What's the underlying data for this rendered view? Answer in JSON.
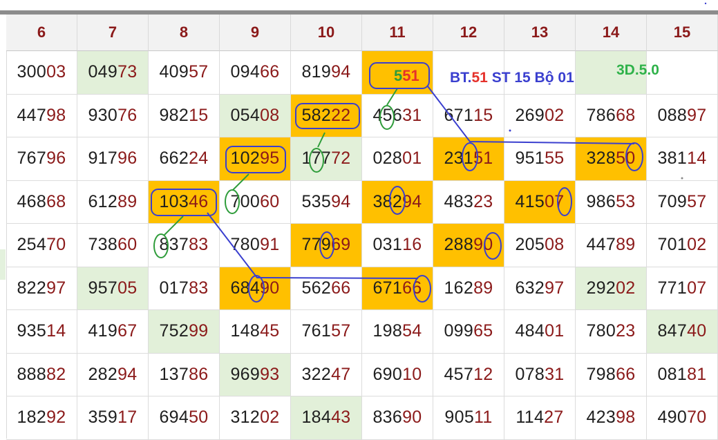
{
  "headers": [
    "6",
    "7",
    "8",
    "9",
    "10",
    "11",
    "12",
    "13",
    "14",
    "15"
  ],
  "rows": [
    [
      {
        "h": "300",
        "l": "03"
      },
      {
        "h": "049",
        "l": "73",
        "g": 1
      },
      {
        "h": "409",
        "l": "57"
      },
      {
        "h": "094",
        "l": "66"
      },
      {
        "h": "819",
        "l": "94"
      },
      {
        "o": 1,
        "blank": 1
      },
      {
        "blank": 1
      },
      {
        "blank": 1
      },
      {
        "g": 1,
        "blank": 1
      },
      {
        "blank": 1
      }
    ],
    [
      {
        "h": "447",
        "l": "98"
      },
      {
        "h": "930",
        "l": "76"
      },
      {
        "h": "982",
        "l": "15"
      },
      {
        "h": "054",
        "l": "08",
        "g": 1
      },
      {
        "h": "582",
        "l": "22",
        "o": 1
      },
      {
        "h": "456",
        "l": "31"
      },
      {
        "h": "671",
        "l": "15"
      },
      {
        "h": "269",
        "l": "02"
      },
      {
        "h": "786",
        "l": "68"
      },
      {
        "h": "088",
        "l": "97"
      }
    ],
    [
      {
        "h": "767",
        "l": "96"
      },
      {
        "h": "917",
        "l": "96"
      },
      {
        "h": "662",
        "l": "24"
      },
      {
        "h": "102",
        "l": "95",
        "o": 1
      },
      {
        "h": "177",
        "l": "72",
        "g": 1
      },
      {
        "h": "028",
        "l": "01"
      },
      {
        "h": "231",
        "l": "51",
        "o": 1
      },
      {
        "h": "951",
        "l": "55"
      },
      {
        "h": "328",
        "l": "50",
        "o": 1
      },
      {
        "h": "381",
        "l": "14"
      }
    ],
    [
      {
        "h": "468",
        "l": "68"
      },
      {
        "h": "612",
        "l": "89"
      },
      {
        "h": "103",
        "l": "46",
        "o": 1
      },
      {
        "h": "700",
        "l": "60"
      },
      {
        "h": "535",
        "l": "94"
      },
      {
        "h": "382",
        "l": "94",
        "o": 1
      },
      {
        "h": "483",
        "l": "23"
      },
      {
        "h": "415",
        "l": "07",
        "o": 1
      },
      {
        "h": "986",
        "l": "53"
      },
      {
        "h": "709",
        "l": "57"
      }
    ],
    [
      {
        "h": "254",
        "l": "70"
      },
      {
        "h": "738",
        "l": "60"
      },
      {
        "h": "837",
        "l": "83"
      },
      {
        "h": "780",
        "l": "91"
      },
      {
        "h": "779",
        "l": "69",
        "o": 1
      },
      {
        "h": "031",
        "l": "16"
      },
      {
        "h": "288",
        "l": "90",
        "o": 1
      },
      {
        "h": "205",
        "l": "08"
      },
      {
        "h": "447",
        "l": "89"
      },
      {
        "h": "701",
        "l": "02"
      }
    ],
    [
      {
        "h": "822",
        "l": "97"
      },
      {
        "h": "957",
        "l": "05",
        "g": 1
      },
      {
        "h": "017",
        "l": "83"
      },
      {
        "h": "684",
        "l": "90",
        "o": 1
      },
      {
        "h": "562",
        "l": "66"
      },
      {
        "h": "671",
        "l": "66",
        "o": 1
      },
      {
        "h": "162",
        "l": "89"
      },
      {
        "h": "632",
        "l": "97"
      },
      {
        "h": "292",
        "l": "02",
        "g": 1
      },
      {
        "h": "771",
        "l": "07"
      }
    ],
    [
      {
        "h": "935",
        "l": "14"
      },
      {
        "h": "419",
        "l": "67"
      },
      {
        "h": "752",
        "l": "99",
        "g": 1
      },
      {
        "h": "148",
        "l": "45"
      },
      {
        "h": "761",
        "l": "57"
      },
      {
        "h": "198",
        "l": "54"
      },
      {
        "h": "099",
        "l": "65"
      },
      {
        "h": "484",
        "l": "01"
      },
      {
        "h": "780",
        "l": "23"
      },
      {
        "h": "847",
        "l": "40",
        "g": 1
      }
    ],
    [
      {
        "h": "888",
        "l": "82"
      },
      {
        "h": "282",
        "l": "94"
      },
      {
        "h": "137",
        "l": "86"
      },
      {
        "h": "969",
        "l": "93",
        "g": 1
      },
      {
        "h": "322",
        "l": "47"
      },
      {
        "h": "690",
        "l": "10"
      },
      {
        "h": "457",
        "l": "12"
      },
      {
        "h": "078",
        "l": "31"
      },
      {
        "h": "798",
        "l": "66"
      },
      {
        "h": "081",
        "l": "81"
      }
    ],
    [
      {
        "h": "182",
        "l": "92"
      },
      {
        "h": "359",
        "l": "17"
      },
      {
        "h": "694",
        "l": "50"
      },
      {
        "h": "312",
        "l": "02"
      },
      {
        "h": "184",
        "l": "43",
        "g": 1
      },
      {
        "h": "836",
        "l": "90"
      },
      {
        "h": "905",
        "l": "11"
      },
      {
        "h": "114",
        "l": "27"
      },
      {
        "h": "423",
        "l": "98"
      },
      {
        "h": "490",
        "l": "70"
      }
    ]
  ],
  "annotations": {
    "badge_digit1": "5",
    "badge_digits2": "51",
    "bt_prefix": "BT.",
    "bt_num": "51",
    "bt_rest": " ST 15 Bộ 01",
    "version": "3D.5.0"
  },
  "colors": {
    "orange": "#ffc000",
    "green": "#e2f0d9",
    "header_text": "#8b1a1a",
    "circle_blue": "#3a3fcf",
    "line_green": "#2e9c3a"
  }
}
